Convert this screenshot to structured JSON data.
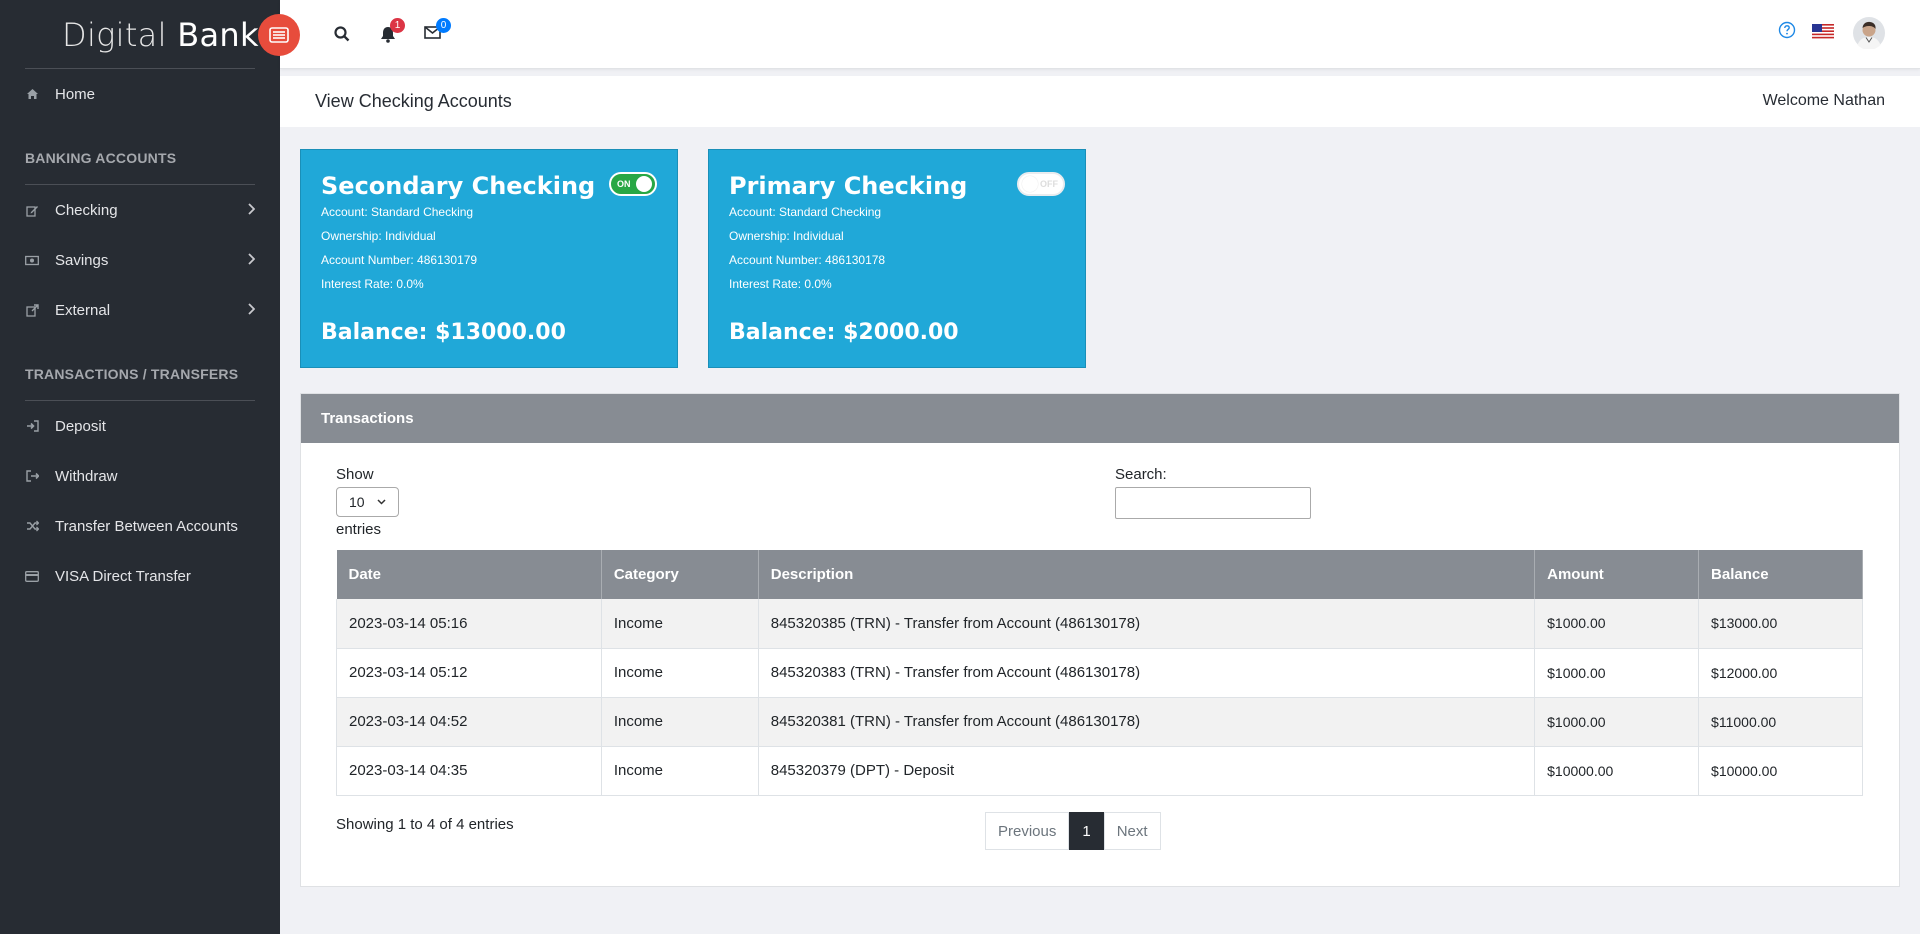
{
  "brand": {
    "light": "Digital",
    "bold": "Bank"
  },
  "sidebar": {
    "home": "Home",
    "sections": [
      {
        "title": "BANKING ACCOUNTS"
      },
      {
        "title": "TRANSACTIONS / TRANSFERS"
      }
    ],
    "banking_items": [
      {
        "label": "Checking",
        "icon": "edit-icon"
      },
      {
        "label": "Savings",
        "icon": "money-icon"
      },
      {
        "label": "External",
        "icon": "external-link-icon"
      }
    ],
    "transfer_items": [
      {
        "label": "Deposit",
        "icon": "sign-in-icon"
      },
      {
        "label": "Withdraw",
        "icon": "sign-out-icon"
      },
      {
        "label": "Transfer Between Accounts",
        "icon": "shuffle-icon"
      },
      {
        "label": "VISA Direct Transfer",
        "icon": "credit-card-icon"
      }
    ]
  },
  "header": {
    "notifications_count": "1",
    "messages_count": "0"
  },
  "page": {
    "title": "View Checking Accounts",
    "welcome": "Welcome Nathan"
  },
  "accounts": [
    {
      "name": "Secondary Checking",
      "account": "Account: Standard Checking",
      "ownership": "Ownership: Individual",
      "number": "Account Number: 486130179",
      "rate": "Interest Rate: 0.0%",
      "balance": "Balance: $13000.00",
      "toggle": "ON"
    },
    {
      "name": "Primary Checking",
      "account": "Account: Standard Checking",
      "ownership": "Ownership: Individual",
      "number": "Account Number: 486130178",
      "rate": "Interest Rate: 0.0%",
      "balance": "Balance: $2000.00",
      "toggle": "OFF"
    }
  ],
  "transactions": {
    "title": "Transactions",
    "show_label": "Show",
    "show_value": "10",
    "entries_label": "entries",
    "search_label": "Search:",
    "columns": [
      "Date",
      "Category",
      "Description",
      "Amount",
      "Balance"
    ],
    "rows": [
      [
        "2023-03-14 05:16",
        "Income",
        "845320385 (TRN) - Transfer from Account (486130178)",
        "$1000.00",
        "$13000.00"
      ],
      [
        "2023-03-14 05:12",
        "Income",
        "845320383 (TRN) - Transfer from Account (486130178)",
        "$1000.00",
        "$12000.00"
      ],
      [
        "2023-03-14 04:52",
        "Income",
        "845320381 (TRN) - Transfer from Account (486130178)",
        "$1000.00",
        "$11000.00"
      ],
      [
        "2023-03-14 04:35",
        "Income",
        "845320379 (DPT) - Deposit",
        "$10000.00",
        "$10000.00"
      ]
    ],
    "info": "Showing 1 to 4 of 4 entries",
    "pager": {
      "previous": "Previous",
      "current": "1",
      "next": "Next"
    }
  },
  "colors": {
    "sidebar_bg": "#272c33",
    "card_bg": "#20a8d8",
    "toggle_red": "#e74c3c",
    "header_gray": "#878c93",
    "switch_on": "#28a745"
  }
}
